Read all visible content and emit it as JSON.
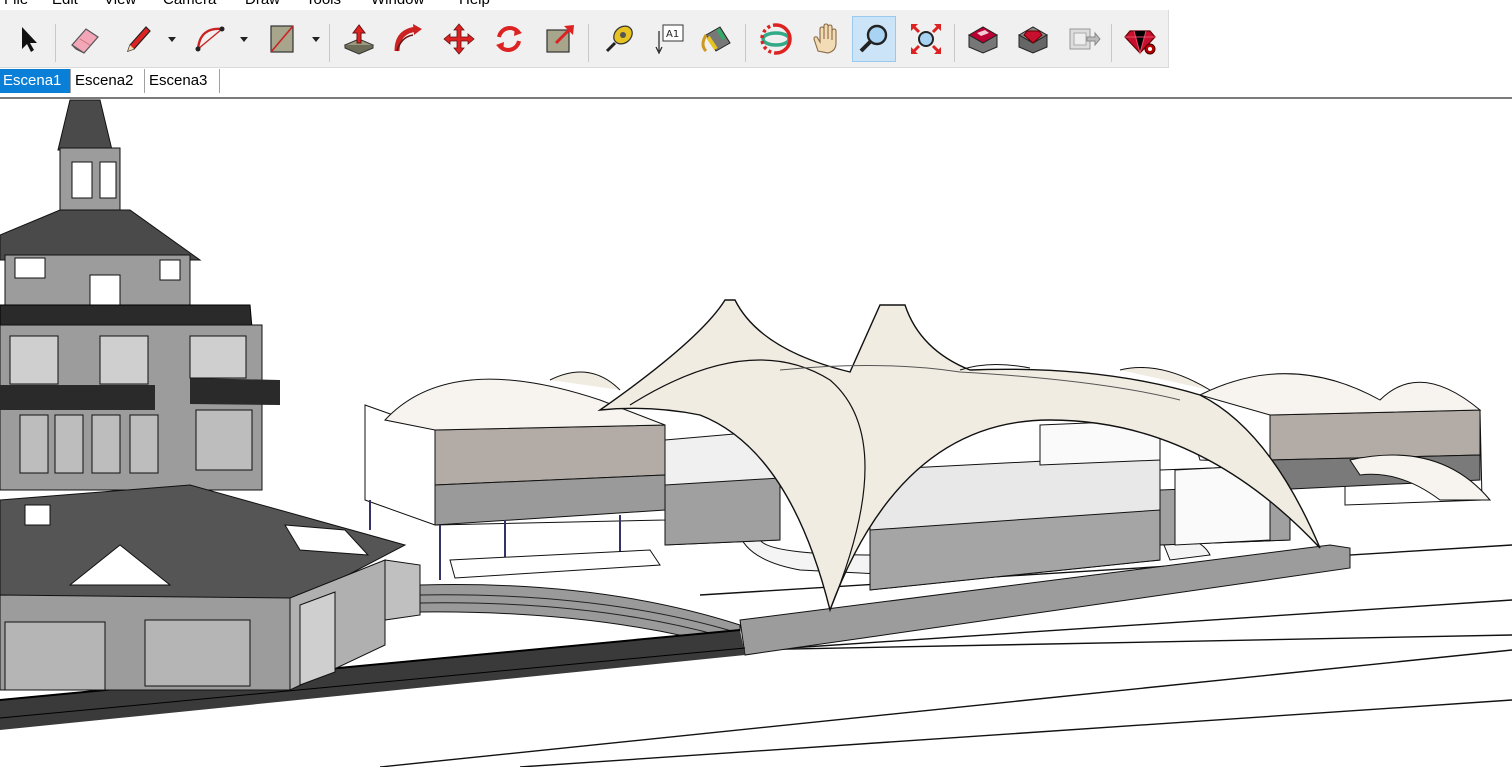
{
  "menu": [
    "File",
    "Edit",
    "View",
    "Camera",
    "Draw",
    "Tools",
    "Window",
    "Help"
  ],
  "toolbar": {
    "tools": [
      {
        "name": "select",
        "icon": "arrow-cursor-icon"
      },
      {
        "name": "eraser",
        "icon": "eraser-icon"
      },
      {
        "name": "line",
        "icon": "pencil-icon"
      },
      {
        "name": "arc",
        "icon": "arc-icon"
      },
      {
        "name": "rectangle",
        "icon": "rectangle-icon"
      },
      {
        "name": "push-pull",
        "icon": "push-pull-icon"
      },
      {
        "name": "follow-me",
        "icon": "follow-me-icon"
      },
      {
        "name": "move",
        "icon": "move-icon"
      },
      {
        "name": "rotate",
        "icon": "rotate-icon"
      },
      {
        "name": "scale",
        "icon": "scale-icon"
      },
      {
        "name": "tape-measure",
        "icon": "tape-measure-icon"
      },
      {
        "name": "text",
        "icon": "text-icon",
        "label": "A1"
      },
      {
        "name": "paint-bucket",
        "icon": "paint-bucket-icon"
      },
      {
        "name": "orbit",
        "icon": "orbit-icon"
      },
      {
        "name": "pan",
        "icon": "hand-icon"
      },
      {
        "name": "zoom",
        "icon": "zoom-icon",
        "active": true
      },
      {
        "name": "zoom-extents",
        "icon": "zoom-extents-icon"
      },
      {
        "name": "warehouse",
        "icon": "warehouse-icon"
      },
      {
        "name": "extension-warehouse",
        "icon": "extension-warehouse-icon"
      },
      {
        "name": "send-to-layout",
        "icon": "layout-icon"
      },
      {
        "name": "ruby-console",
        "icon": "ruby-icon"
      }
    ]
  },
  "scenes": {
    "tabs": [
      "Escena1",
      "Escena2",
      "Escena3"
    ],
    "active": 0
  },
  "colors": {
    "accent": "#0a7fd8",
    "toolbar_bg": "#f0f0f0",
    "ruby_red": "#c8102e"
  }
}
